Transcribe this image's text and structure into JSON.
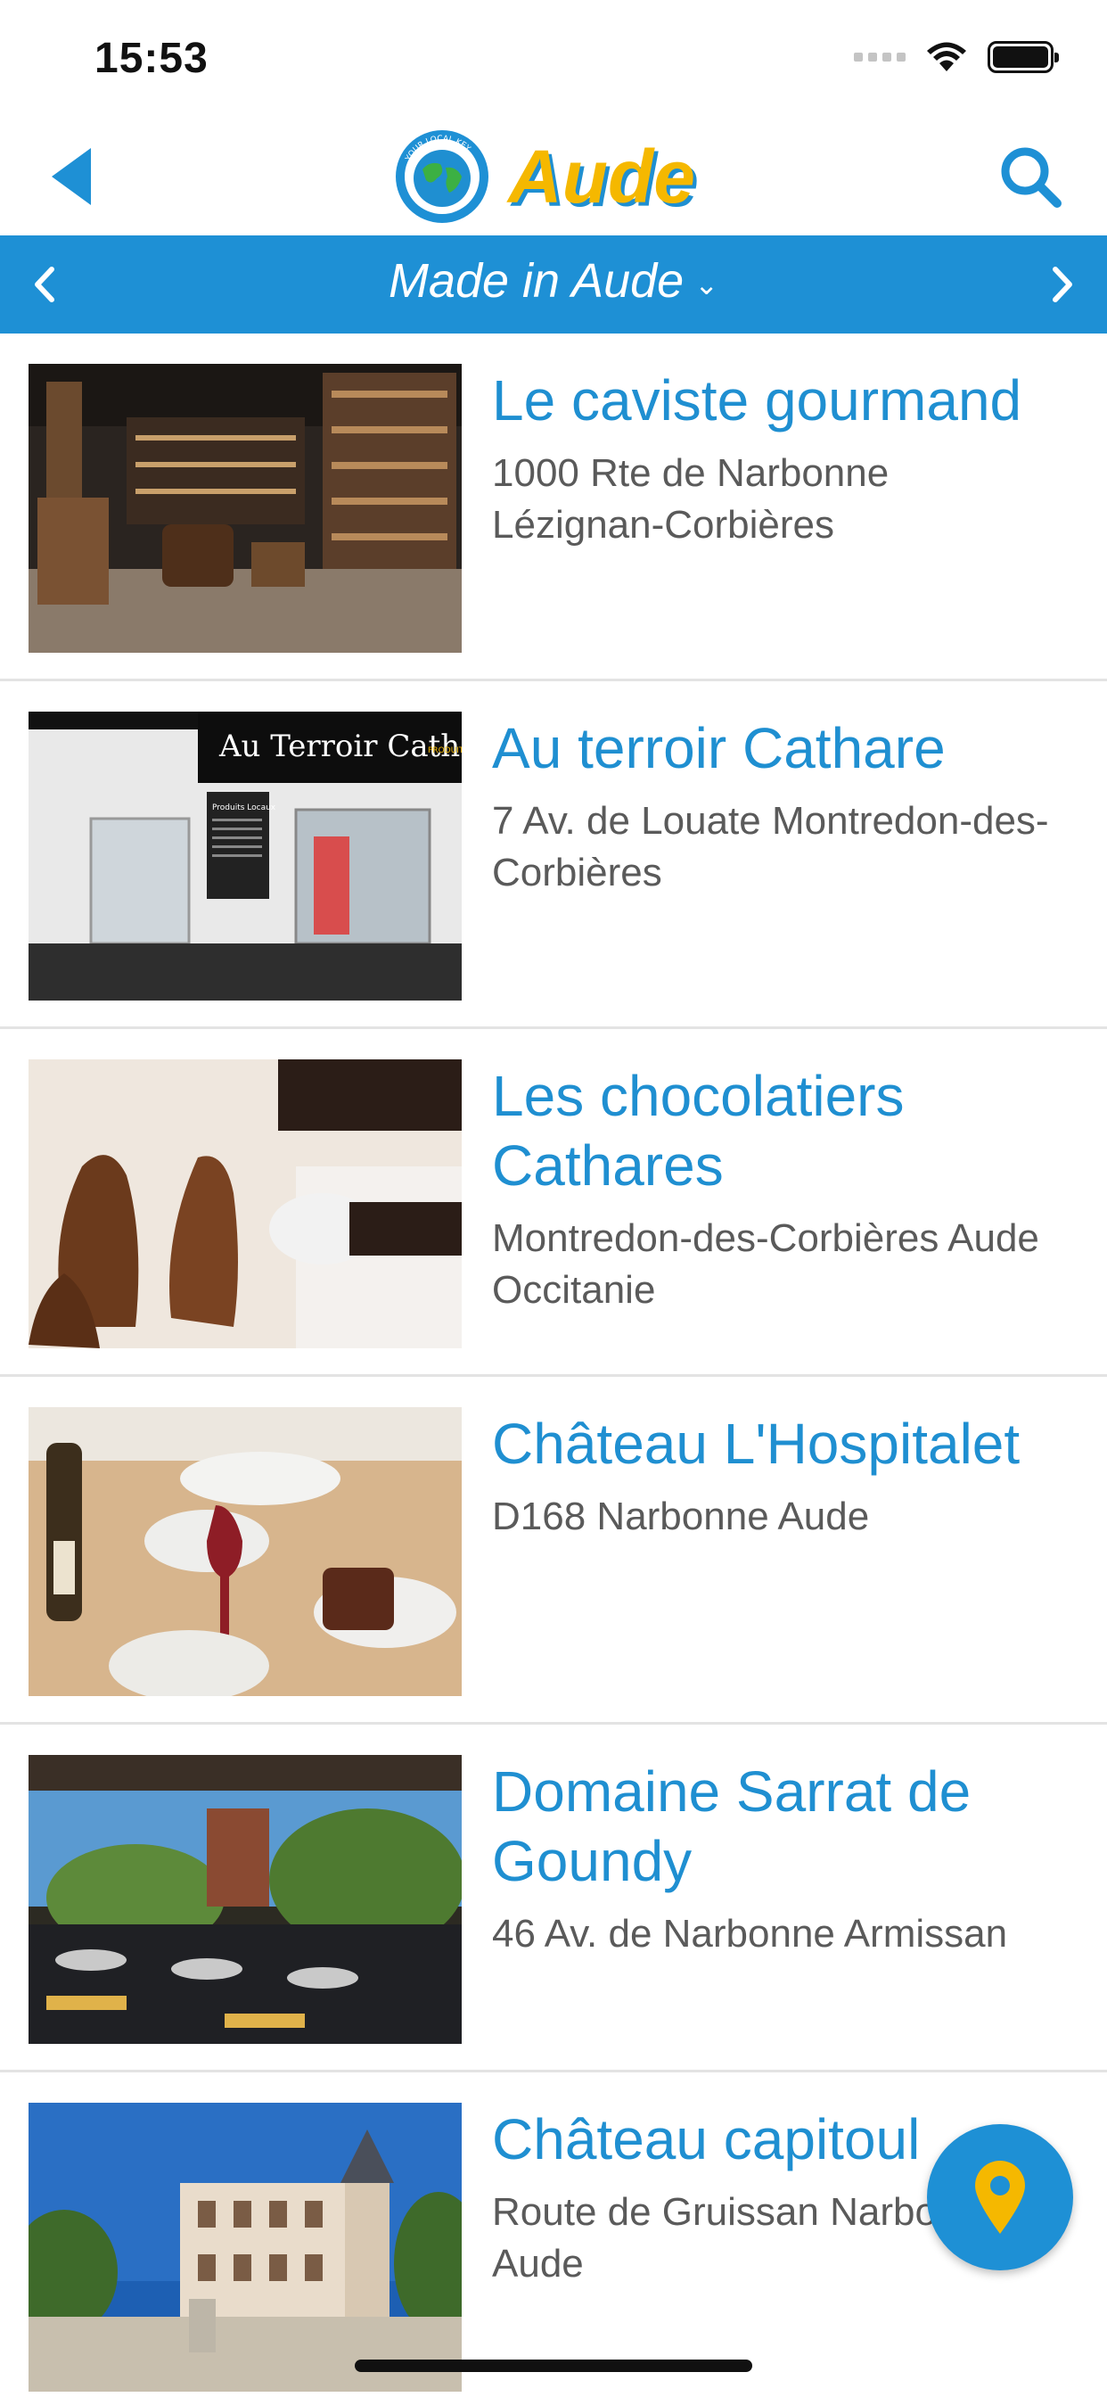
{
  "status_bar": {
    "time": "15:53"
  },
  "header": {
    "title": "Aude",
    "logo_ring_text": "YOUR LOCAL KEY",
    "back_icon": "back-chevron-icon",
    "search_icon": "search-icon"
  },
  "category": {
    "title": "Made in Aude",
    "dropdown_icon": "chevron-down-icon"
  },
  "items": [
    {
      "title": "Le caviste gourmand",
      "address": "1000 Rte de Narbonne Lézignan-Corbières"
    },
    {
      "title": "Au terroir Cathare",
      "address": "7 Av. de Louate Montredon-des-Corbières",
      "sign_text": "Au Terroir Cathare",
      "sign_sub": "PRODUITS LOCAUX",
      "board_text": "Produits Locaux"
    },
    {
      "title": "Les chocolatiers Cathares",
      "address": "Montredon-des-Corbières Aude Occitanie"
    },
    {
      "title": "Château L'Hospitalet",
      "address": "D168 Narbonne Aude"
    },
    {
      "title": "Domaine Sarrat de Goundy",
      "address": "46 Av. de Narbonne Armissan"
    },
    {
      "title": "Château capitoul",
      "address": "Route de Gruissan Narbonne Aude"
    }
  ],
  "fab": {
    "icon": "map-pin-icon"
  },
  "colors": {
    "accent": "#1e90d5",
    "logo_yellow": "#f5b800",
    "title_blue": "#1f8fd1",
    "address_gray": "#5a5a5a"
  }
}
